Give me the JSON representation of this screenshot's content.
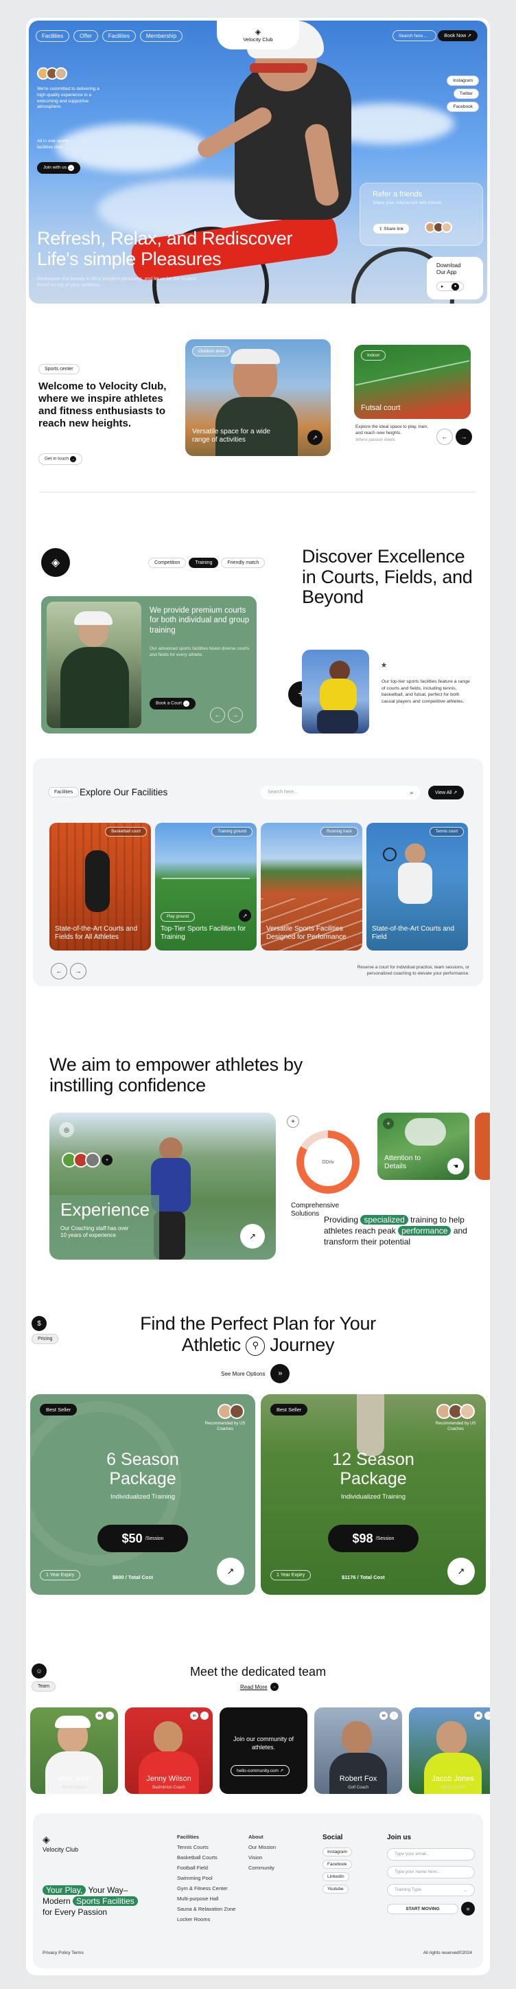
{
  "hero": {
    "nav": [
      "Facilities",
      "Offer",
      "Facilities",
      "Membership"
    ],
    "logo": "Velocity Club",
    "search_placeholder": "Search here...",
    "book_now": "Book Now",
    "socials": [
      "Instagram",
      "Twitter",
      "Facebook"
    ],
    "intro": "We're committed to delivering a high-quality experience in a welcoming and supportive atmosphere.",
    "all_in_one": "All in one sports facilities club",
    "join": "Join with us",
    "title": "Refresh, Relax, and Rediscover Life's simple Pleasures",
    "subtitle": "Rediscover the beauty in life's simplest pleasures, and let us be the trusted friend on top of your wellness.",
    "refer_title": "Refer a friends",
    "refer_sub": "Share your referral link with friends",
    "share": "Share link",
    "download": "Download Our App"
  },
  "welcome": {
    "tag": "Sports center",
    "title": "Welcome to Velocity Club, where we inspire athletes and fitness enthusiasts to reach new heights.",
    "cta": "Get in touch",
    "card1_tag": "Outdoor area",
    "card1_text": "Versatile space for a wide range of activities",
    "card2_tag": "Indoor",
    "card2_text": "Futsal court",
    "card2_desc": "Explore the ideal space to play, train, and reach new heights.",
    "card2_small": "Where passion meets"
  },
  "discover": {
    "tabs": [
      "Competition",
      "Training",
      "Friendly match"
    ],
    "title": "Discover Excellence in Courts, Fields, and Beyond",
    "card_text": "We provide premium courts for both individual and group training",
    "card_sub": "Our advanced sports facilities boast diverse courts and fields for every athlete.",
    "book": "Book a Court",
    "star": "*",
    "desc": "Our top-tier sports facilities feature a range of courts and fields, including tennis, basketball, and futsal, perfect for both casual players and competitive athletes."
  },
  "facilities": {
    "tag": "Facilities",
    "title": "Explore Our Facilities",
    "search_placeholder": "Search here...",
    "view_all": "View All",
    "items": [
      {
        "tag": "Basketball court",
        "label": "State-of-the-Art Courts and Fields for All Athletes"
      },
      {
        "tag": "Training ground",
        "label": "Top-Tier Sports Facilities for Training",
        "extra": "Play ground"
      },
      {
        "tag": "Running track",
        "label": "Versatile Sports Facilities Designed for Performance"
      },
      {
        "tag": "Tennis court",
        "label": "State-of-the-Art Courts and Field"
      }
    ],
    "note": "Reserve a court for individual practice, team sessions, or personalized coaching to elevate your performance."
  },
  "empower": {
    "title": "We aim to empower athletes by instilling confidence",
    "exp": "Experience",
    "exp_sub": "Our Coaching staff has over 10 years of experience",
    "gauge": "Comprehensive Solutions",
    "gauge_val": "DDriv",
    "attention": "Attention to Details",
    "sentence_a": "Providing",
    "sentence_h1": "specialized",
    "sentence_b": "training to help athletes reach peak",
    "sentence_h2": "performance",
    "sentence_c": "and transform their potential"
  },
  "pricing": {
    "tag": "Pricing",
    "title_a": "Find the Perfect Plan for Your",
    "title_b": "Athletic",
    "title_c": "Journey",
    "more": "See More Options",
    "plans": [
      {
        "badge": "Best Seller",
        "rec": "Recommended by US Coaches",
        "name": "6 Season Package",
        "type": "Individualized Training",
        "price": "$50",
        "per": "/Session",
        "expiry": "1 Year Expiry",
        "total": "$600 / Total Cost"
      },
      {
        "badge": "Best Seller",
        "rec": "Recommended by US Coaches",
        "name": "12 Season Package",
        "type": "Individualized Training",
        "price": "$98",
        "per": "/Session",
        "expiry": "1 Year Expiry",
        "total": "$1176 / Total Cost"
      }
    ]
  },
  "team": {
    "tag": "Team",
    "title": "Meet the dedicated team",
    "more": "Read More",
    "community": "Join our community of athletes.",
    "link": "hello-community.com",
    "members": [
      {
        "name": "Alex Josh",
        "role": "Tennis Coach"
      },
      {
        "name": "Jenny Wilson",
        "role": "Badminton Coach"
      },
      {
        "name": "Robert Fox",
        "role": "Golf Coach"
      },
      {
        "name": "Jacob Jones",
        "role": "Tennis Coach"
      }
    ]
  },
  "footer": {
    "logo": "Velocity Club",
    "tag_a": "Your Play,",
    "tag_b": "Your Way–",
    "tag_c": "Modern",
    "tag_d": "Sports Facilities",
    "tag_e": "for Every Passion",
    "facilities_h": "Facilities",
    "facilities": [
      "Tennis Courts",
      "Basketball Courts",
      "Football Field",
      "Swimming Pool",
      "Gym & Fitness Center",
      "Multi-purpose Hall",
      "Sauna & Relaxation Zone",
      "Locker Rooms"
    ],
    "about_h": "About",
    "about": [
      "Our Mission",
      "Vision",
      "Community"
    ],
    "social_h": "Social",
    "social": [
      "Instagram",
      "Facebook",
      "LinkedIn",
      "Youtube"
    ],
    "join_h": "Join us",
    "inputs": [
      "Type your email...",
      "Type your name here...",
      "Training Type"
    ],
    "start": "START MOVING",
    "privacy": "Privacy Policy Terms",
    "rights": "All rights reserved©2024"
  },
  "colors": {
    "green": "#6f9c7a",
    "accent": "#2b8a5a",
    "dark": "#111111"
  }
}
